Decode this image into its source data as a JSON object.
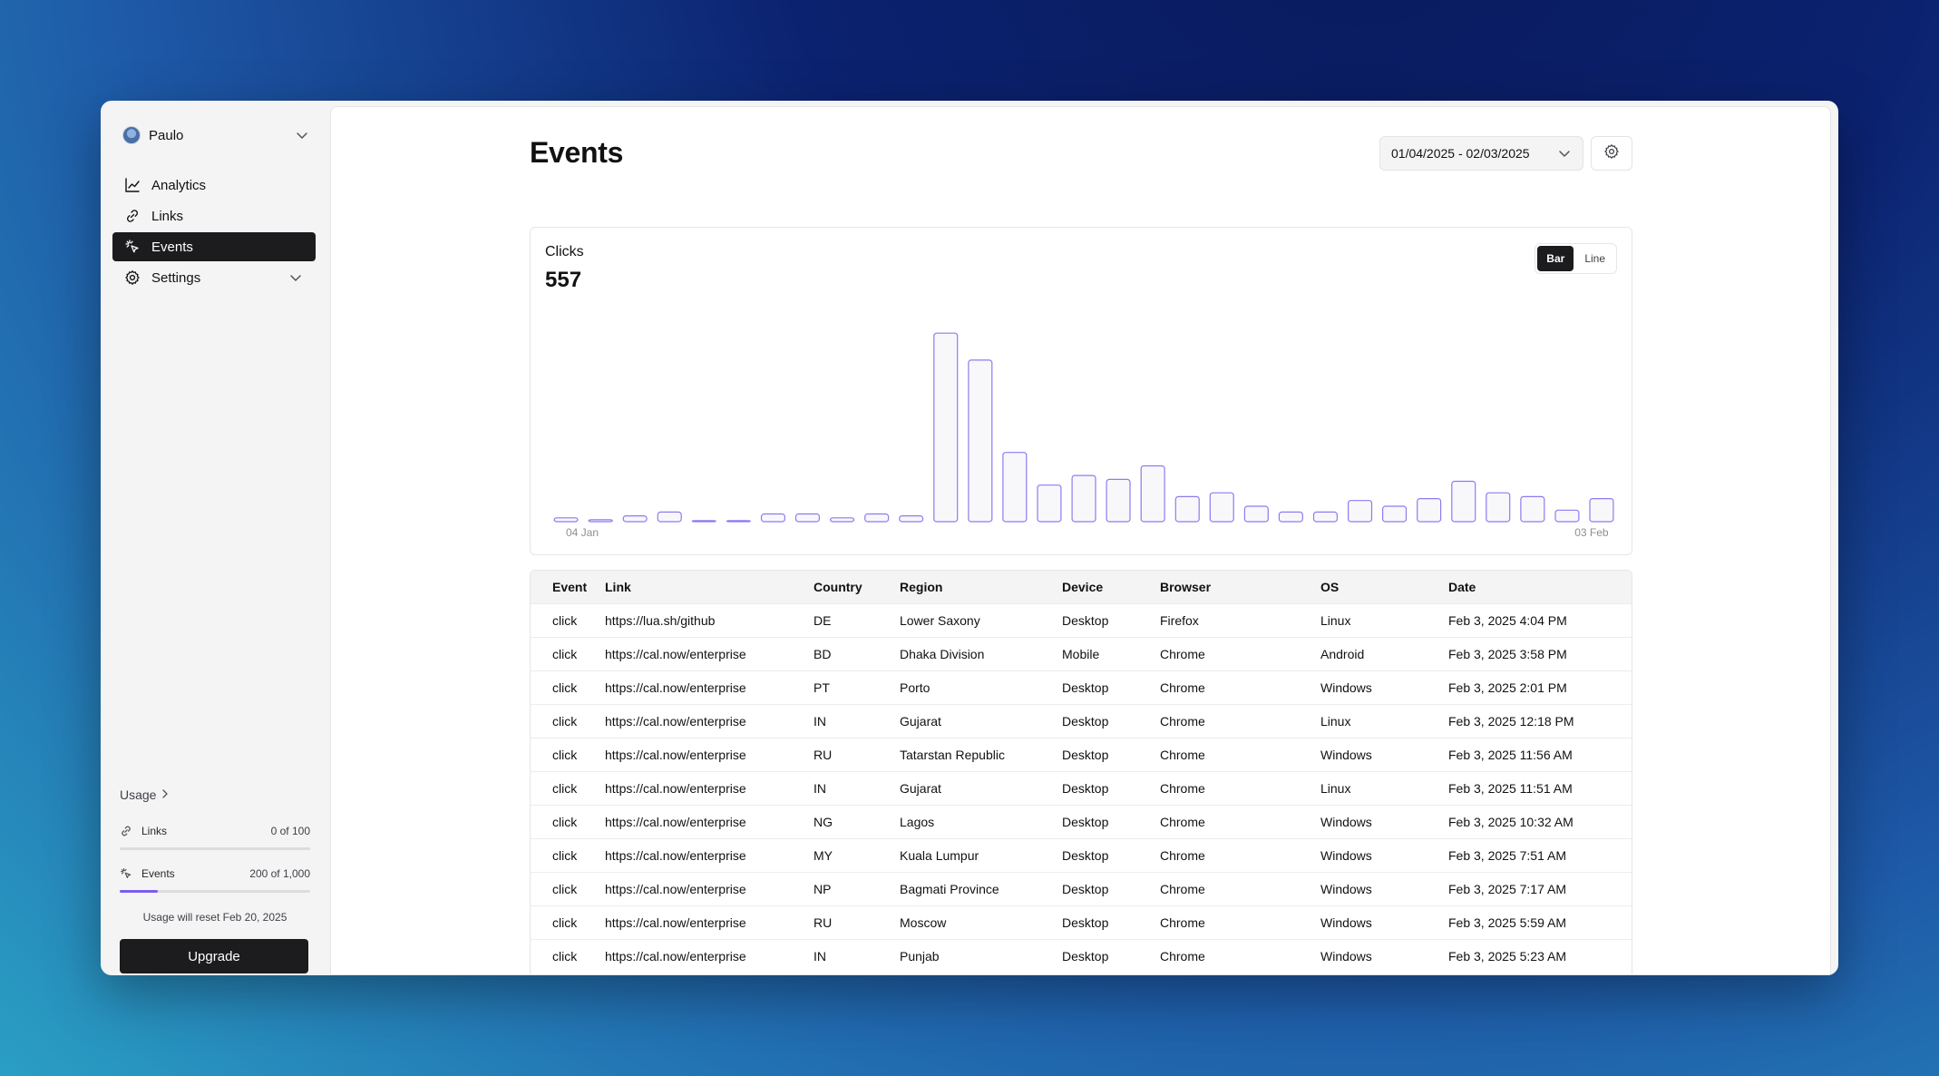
{
  "account": {
    "name": "Paulo"
  },
  "nav": [
    {
      "label": "Analytics",
      "icon": "chart-line-icon"
    },
    {
      "label": "Links",
      "icon": "link-icon"
    },
    {
      "label": "Events",
      "icon": "cursor-click-icon",
      "active": true
    },
    {
      "label": "Settings",
      "icon": "gear-icon"
    }
  ],
  "usage": {
    "title": "Usage",
    "links": {
      "label": "Links",
      "value": "0 of 100",
      "fraction": 0
    },
    "events": {
      "label": "Events",
      "value": "200 of 1,000",
      "fraction": 0.2
    },
    "reset_note": "Usage will reset Feb 20, 2025",
    "upgrade_label": "Upgrade"
  },
  "page": {
    "title": "Events",
    "date_range": "01/04/2025 - 02/03/2025"
  },
  "chart": {
    "label": "Clicks",
    "total": "557",
    "toggle": {
      "bar": "Bar",
      "line": "Line",
      "selected": "Bar"
    }
  },
  "chart_data": {
    "type": "bar",
    "title": "Clicks",
    "x_tick_labels": [
      "04 Jan",
      "03 Feb"
    ],
    "x_start": "04 Jan",
    "x_end": "03 Feb",
    "values": [
      2,
      1,
      3,
      5,
      0.5,
      0.5,
      4,
      4,
      2,
      4,
      3,
      98,
      84,
      36,
      19,
      24,
      22,
      29,
      13,
      15,
      8,
      5,
      5,
      11,
      8,
      12,
      21,
      15,
      13,
      6,
      12
    ],
    "ylim": [
      0,
      100
    ],
    "bar_fill": "#f8f8fb",
    "bar_stroke": "#8b7cf0",
    "grid": false,
    "legend": "none"
  },
  "table": {
    "columns": [
      "Event",
      "Link",
      "Country",
      "Region",
      "Device",
      "Browser",
      "OS",
      "Date"
    ],
    "rows": [
      [
        "click",
        "https://lua.sh/github",
        "DE",
        "Lower Saxony",
        "Desktop",
        "Firefox",
        "Linux",
        "Feb 3, 2025 4:04 PM"
      ],
      [
        "click",
        "https://cal.now/enterprise",
        "BD",
        "Dhaka Division",
        "Mobile",
        "Chrome",
        "Android",
        "Feb 3, 2025 3:58 PM"
      ],
      [
        "click",
        "https://cal.now/enterprise",
        "PT",
        "Porto",
        "Desktop",
        "Chrome",
        "Windows",
        "Feb 3, 2025 2:01 PM"
      ],
      [
        "click",
        "https://cal.now/enterprise",
        "IN",
        "Gujarat",
        "Desktop",
        "Chrome",
        "Linux",
        "Feb 3, 2025 12:18 PM"
      ],
      [
        "click",
        "https://cal.now/enterprise",
        "RU",
        "Tatarstan Republic",
        "Desktop",
        "Chrome",
        "Windows",
        "Feb 3, 2025 11:56 AM"
      ],
      [
        "click",
        "https://cal.now/enterprise",
        "IN",
        "Gujarat",
        "Desktop",
        "Chrome",
        "Linux",
        "Feb 3, 2025 11:51 AM"
      ],
      [
        "click",
        "https://cal.now/enterprise",
        "NG",
        "Lagos",
        "Desktop",
        "Chrome",
        "Windows",
        "Feb 3, 2025 10:32 AM"
      ],
      [
        "click",
        "https://cal.now/enterprise",
        "MY",
        "Kuala Lumpur",
        "Desktop",
        "Chrome",
        "Windows",
        "Feb 3, 2025 7:51 AM"
      ],
      [
        "click",
        "https://cal.now/enterprise",
        "NP",
        "Bagmati Province",
        "Desktop",
        "Chrome",
        "Windows",
        "Feb 3, 2025 7:17 AM"
      ],
      [
        "click",
        "https://cal.now/enterprise",
        "RU",
        "Moscow",
        "Desktop",
        "Chrome",
        "Windows",
        "Feb 3, 2025 5:59 AM"
      ],
      [
        "click",
        "https://cal.now/enterprise",
        "IN",
        "Punjab",
        "Desktop",
        "Chrome",
        "Windows",
        "Feb 3, 2025 5:23 AM"
      ]
    ]
  }
}
